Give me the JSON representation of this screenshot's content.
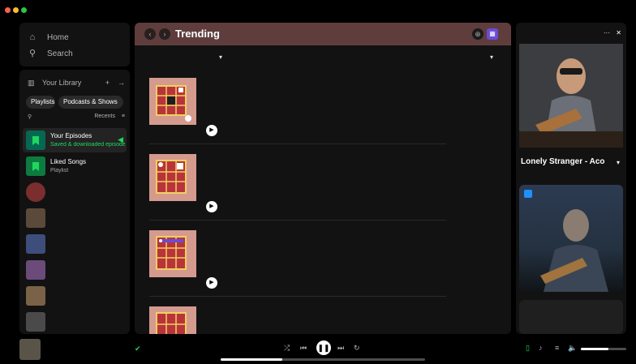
{
  "window": {
    "traffic_colors": [
      "#ff5f57",
      "#febc2e",
      "#28c840"
    ]
  },
  "nav": {
    "home_label": "Home",
    "search_label": "Search"
  },
  "library": {
    "title": "Your Library",
    "chips": [
      "Playlists",
      "Podcasts & Shows"
    ],
    "sort_label": "Recents",
    "items": [
      {
        "title": "Your Episodes",
        "subtitle": "Saved & downloaded episodes",
        "active": true,
        "pinned": true
      },
      {
        "title": "Liked Songs",
        "subtitle": "Playlist",
        "active": false
      },
      {
        "title": "",
        "subtitle": "",
        "active": false
      },
      {
        "title": "",
        "subtitle": "",
        "active": false
      },
      {
        "title": "",
        "subtitle": "",
        "active": false
      },
      {
        "title": "",
        "subtitle": "",
        "active": false
      },
      {
        "title": "",
        "subtitle": "",
        "active": false
      },
      {
        "title": "",
        "subtitle": "",
        "active": false
      }
    ]
  },
  "main": {
    "title": "Trending",
    "filter_label": "",
    "sort_label": "",
    "episodes": [
      {
        "title": "",
        "show": "",
        "description": "",
        "meta": ""
      },
      {
        "title": "",
        "show": "",
        "description": "",
        "meta": ""
      },
      {
        "title": "",
        "show": "",
        "description": "",
        "meta": ""
      },
      {
        "title": "",
        "show": "",
        "description": "",
        "meta": ""
      }
    ]
  },
  "now_playing_panel": {
    "header": "",
    "song_title": "Lonely Stranger - Aco",
    "artist": "",
    "card_caption": "",
    "card2_label": ""
  },
  "player": {
    "track": "",
    "artist": "",
    "elapsed": "",
    "duration": "",
    "progress": 0.3,
    "volume": 0.6
  },
  "colors": {
    "accent": "#1ed760",
    "header_bg": "#5f3d3d",
    "art_bg": "#d49a8e"
  }
}
